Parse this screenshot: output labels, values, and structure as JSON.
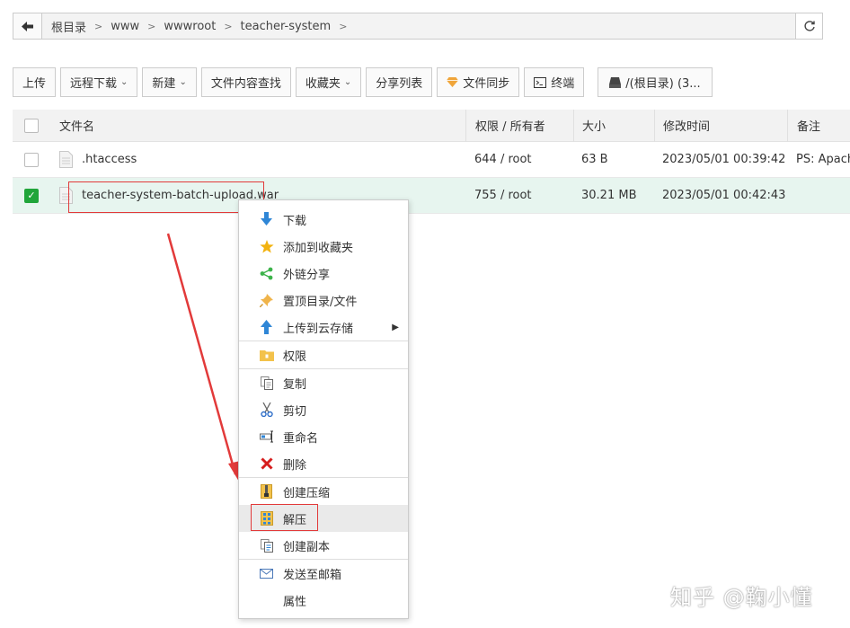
{
  "breadcrumb": {
    "items": [
      "根目录",
      "www",
      "wwwroot",
      "teacher-system"
    ]
  },
  "toolbar": {
    "upload": "上传",
    "remote_download": "远程下载",
    "new": "新建",
    "content_search": "文件内容查找",
    "favorites": "收藏夹",
    "share_list": "分享列表",
    "file_sync": "文件同步",
    "terminal": "终端",
    "disk": "/(根目录) (3..."
  },
  "table": {
    "headers": {
      "name": "文件名",
      "permission": "权限 / 所有者",
      "size": "大小",
      "modified": "修改时间",
      "note": "备注"
    },
    "rows": [
      {
        "name": ".htaccess",
        "permission": "644 / root",
        "size": "63 B",
        "modified": "2023/05/01 00:39:42",
        "note": "PS: Apache",
        "selected": false
      },
      {
        "name": "teacher-system-batch-upload.war",
        "permission": "755 / root",
        "size": "30.21 MB",
        "modified": "2023/05/01 00:42:43",
        "note": "",
        "selected": true
      }
    ]
  },
  "context_menu": {
    "items": [
      {
        "label": "下载",
        "icon": "download-icon"
      },
      {
        "label": "添加到收藏夹",
        "icon": "star-icon"
      },
      {
        "label": "外链分享",
        "icon": "share-icon"
      },
      {
        "label": "置顶目录/文件",
        "icon": "pin-icon"
      },
      {
        "label": "上传到云存储",
        "icon": "upload-cloud-icon"
      },
      {
        "label": "权限",
        "icon": "folder-lock-icon"
      },
      {
        "label": "复制",
        "icon": "copy-icon"
      },
      {
        "label": "剪切",
        "icon": "scissors-icon"
      },
      {
        "label": "重命名",
        "icon": "rename-icon"
      },
      {
        "label": "删除",
        "icon": "delete-icon"
      },
      {
        "label": "创建压缩",
        "icon": "zip-icon"
      },
      {
        "label": "解压",
        "icon": "unzip-icon"
      },
      {
        "label": "创建副本",
        "icon": "duplicate-icon"
      },
      {
        "label": "发送至邮箱",
        "icon": "mail-icon"
      },
      {
        "label": "属性",
        "icon": "properties-icon"
      }
    ]
  },
  "watermark": "知乎 @鞠小懂",
  "colors": {
    "accent_green": "#20a53a",
    "selected_row": "#e7f5ef",
    "annotation_red": "#e23a3a"
  }
}
